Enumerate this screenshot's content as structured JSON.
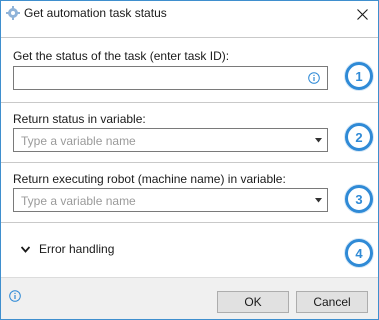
{
  "window": {
    "title": "Get automation task status",
    "accent_color": "#2f8ad6",
    "icons": {
      "app": "gear-app-icon",
      "close": "close-icon"
    }
  },
  "task_id": {
    "label": "Get the status of the task (enter task ID):",
    "value": "",
    "placeholder": "",
    "icon": "info-icon",
    "step": "1"
  },
  "status_var": {
    "label": "Return status in variable:",
    "placeholder": "Type a variable name",
    "icon": "chevron-down-icon",
    "step": "2"
  },
  "robot_var": {
    "label": "Return executing robot (machine name) in variable:",
    "placeholder": "Type a variable name",
    "icon": "chevron-down-icon",
    "step": "3"
  },
  "error_handling": {
    "label": "Error handling",
    "icon": "chevron-down-icon",
    "step": "4"
  },
  "footer": {
    "info_icon": "info-icon",
    "ok_label": "OK",
    "cancel_label": "Cancel"
  }
}
